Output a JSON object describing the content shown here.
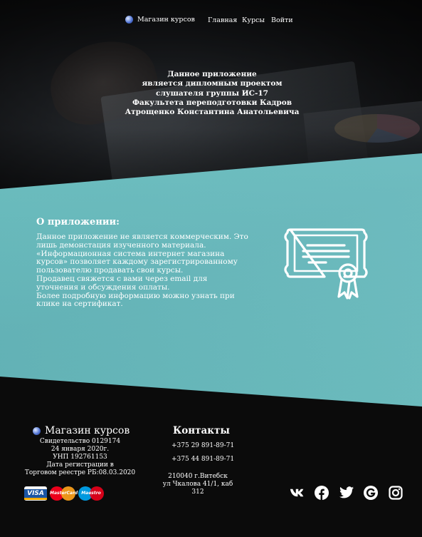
{
  "nav": {
    "brand": "Магазин курсов",
    "home": "Главная",
    "courses": "Курсы",
    "login": "Войти"
  },
  "hero": {
    "lines": [
      "Данное приложение",
      "является дипломным проектом",
      "слушателя группы ИС-17",
      "Факультета переподготовки Кадров",
      "Атрощенко Константина Анатольевича"
    ]
  },
  "about": {
    "title": "О приложении:",
    "paragraphs": [
      "Данное приложение не является коммерческим. Это лишь демонстация изученного материала.",
      "«Информационная система интернет магазина курсов» позволяет каждому зарегистрированному пользователю продавать свои курсы.",
      "Продавец свяжется с вами через email для уточнения и обсуждения оплаты.",
      "Более подробную информацию можно узнать при клике на сертификат."
    ]
  },
  "footer": {
    "brand": "Магазин курсов",
    "registration": [
      "Свидетельство 0129174",
      "24 января 2020г.",
      "УНП 192761153",
      "Дата регистрации в",
      "Торговом реестре РБ:08.03.2020"
    ],
    "payment_cards": {
      "visa": "VISA",
      "mastercard": "MasterCard",
      "maestro": "Maestro"
    },
    "contacts": {
      "title": "Контакты",
      "phone1": "+375 29 891-89-71",
      "phone2": "+375 44 891-89-71",
      "address_line1": "210040 г.Витебск",
      "address_line2": "ул Чкалова 41/1, каб 312"
    },
    "social_icons": [
      "vk-icon",
      "facebook-icon",
      "twitter-icon",
      "google-icon",
      "instagram-icon"
    ]
  },
  "colors": {
    "teal": "#63b7bb",
    "background": "#0b0b0b",
    "text": "#ffffff"
  }
}
